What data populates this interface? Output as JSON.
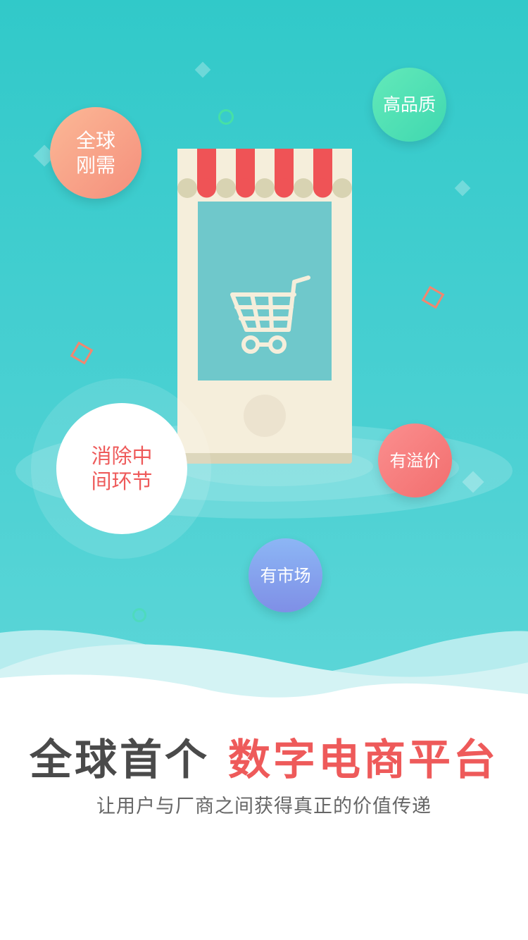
{
  "bubbles": {
    "global_demand_line1": "全球",
    "global_demand_line2": "刚需",
    "high_quality": "高品质",
    "remove_middle_line1": "消除中",
    "remove_middle_line2": "间环节",
    "premium_price": "有溢价",
    "has_market": "有市场"
  },
  "headline": {
    "part1": "全球首个",
    "part2": "数字电商平台"
  },
  "subtitle": "让用户与厂商之间获得真正的价值传递",
  "icons": {
    "phone": "phone-storefront-icon",
    "cart": "shopping-cart-icon"
  },
  "colors": {
    "hero_bg": "#31c9c9",
    "accent_red": "#ee5a5a",
    "text_dark": "#4a4a4a"
  }
}
